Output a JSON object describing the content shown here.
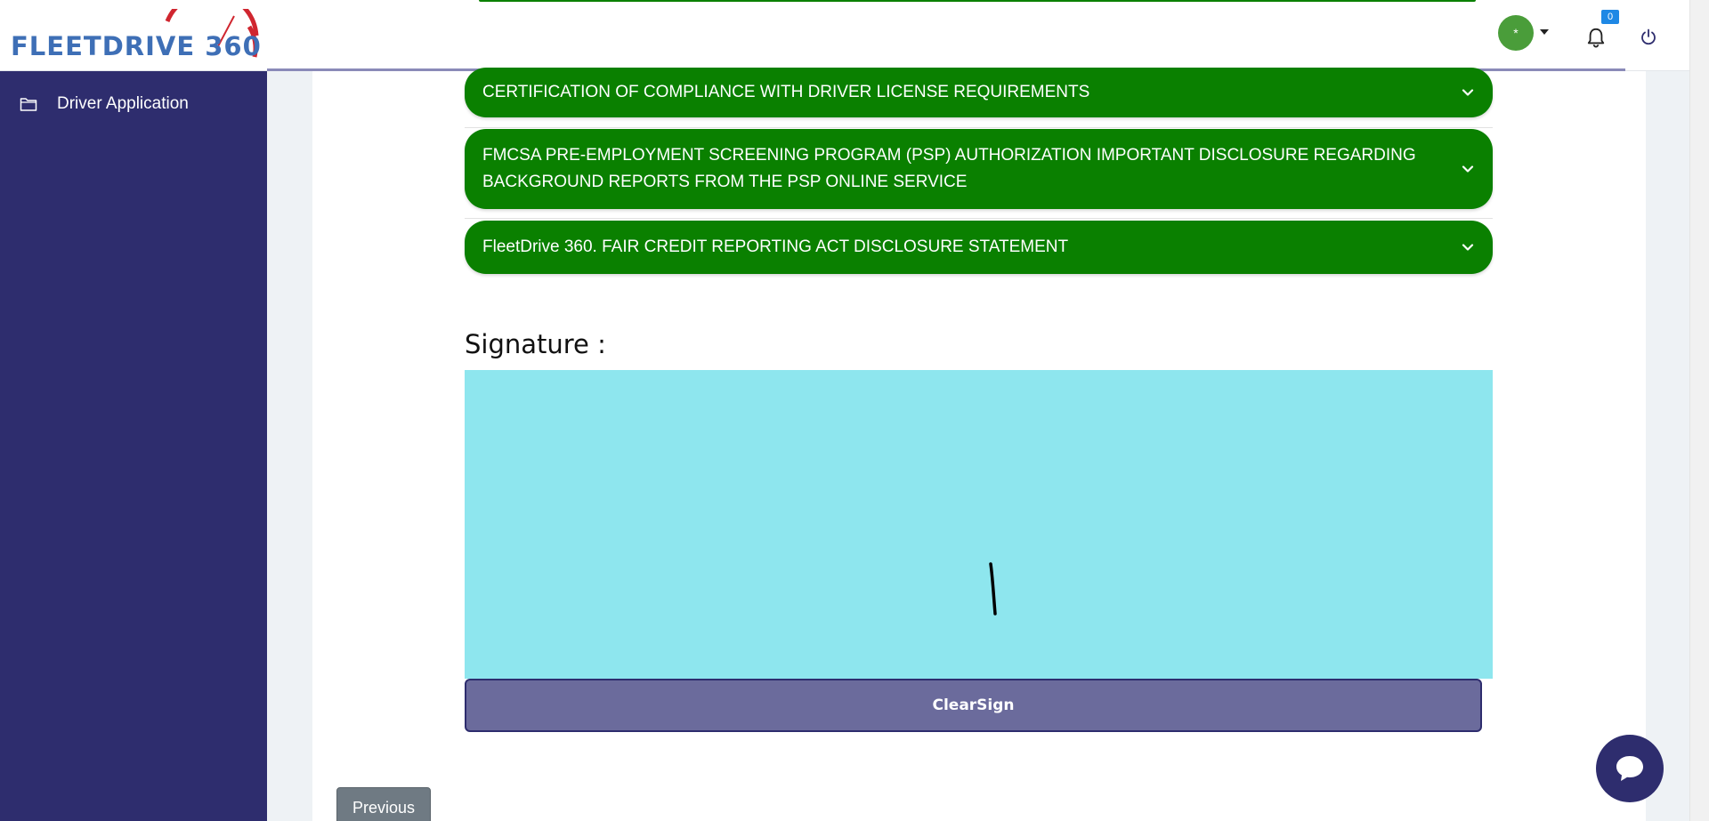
{
  "header": {
    "logo_text": "FLEETDRIVE 360",
    "avatar_initial": "*",
    "notification_count": "0"
  },
  "sidebar": {
    "items": [
      {
        "label": "Driver Application",
        "icon": "folder-icon"
      }
    ]
  },
  "accordions": [
    {
      "title": "CERTIFICATION OF COMPLIANCE WITH DRIVER LICENSE REQUIREMENTS"
    },
    {
      "title": "FMCSA PRE-EMPLOYMENT SCREENING PROGRAM (PSP) AUTHORIZATION IMPORTANT DISCLOSURE REGARDING BACKGROUND REPORTS FROM THE PSP ONLINE SERVICE"
    },
    {
      "title": "FleetDrive 360. FAIR CREDIT REPORTING ACT DISCLOSURE STATEMENT"
    }
  ],
  "signature": {
    "label": "Signature :",
    "clear_button": "ClearSign"
  },
  "navigation": {
    "previous_button": "Previous"
  },
  "colors": {
    "sidebar": "#2e2d6e",
    "accordion": "#0a8000",
    "signature_pad": "#8ee6ee",
    "clear_button": "#6b6b9c",
    "brand_blue": "#3e6fb6",
    "brand_red": "#d0262f"
  }
}
